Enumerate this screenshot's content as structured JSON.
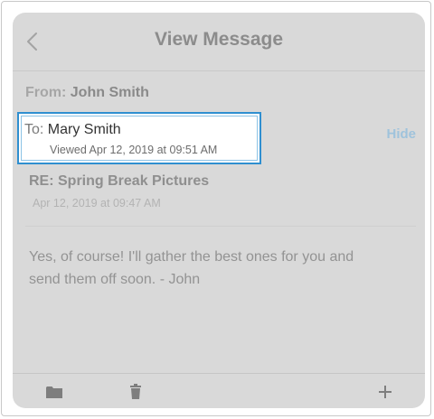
{
  "header": {
    "title": "View Message",
    "back_icon": "chevron-left-icon"
  },
  "message": {
    "from_label": "From:",
    "from_name": "John Smith",
    "to_label": "To:",
    "to_name": "Mary Smith",
    "viewed_text": "Viewed Apr 12, 2019 at 09:51 AM",
    "hide_label": "Hide",
    "subject": "RE: Spring Break Pictures",
    "date": "Apr 12, 2019 at 09:47 AM",
    "body_line1": "Yes, of course! I'll gather the best ones for you and",
    "body_line2": "send them off soon. - John"
  },
  "footer": {
    "folder_icon": "folder-icon",
    "trash_icon": "trash-icon",
    "add_icon": "plus-icon"
  },
  "colors": {
    "highlight_border": "#2f8fd0",
    "link": "#9fc3dc",
    "screen_bg": "#d9d9d9"
  }
}
